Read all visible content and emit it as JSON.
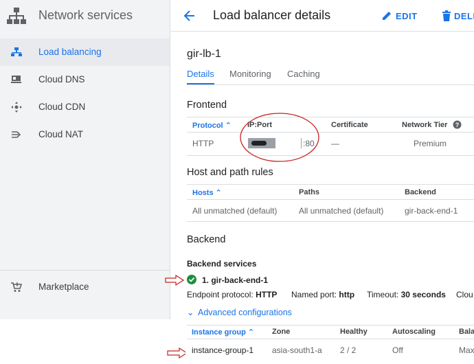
{
  "sidebar": {
    "title": "Network services",
    "items": [
      {
        "label": "Load balancing",
        "icon": "load-balancing-icon",
        "active": true
      },
      {
        "label": "Cloud DNS",
        "icon": "dns-icon"
      },
      {
        "label": "Cloud CDN",
        "icon": "cdn-icon"
      },
      {
        "label": "Cloud NAT",
        "icon": "nat-icon"
      }
    ],
    "bottom_items": [
      {
        "label": "Marketplace",
        "icon": "cart-icon"
      }
    ]
  },
  "topbar": {
    "title": "Load balancer details",
    "edit_label": "EDIT",
    "delete_label": "DELE"
  },
  "lb": {
    "name": "gir-lb-1",
    "tabs": [
      "Details",
      "Monitoring",
      "Caching"
    ]
  },
  "frontend": {
    "heading": "Frontend",
    "headers": {
      "protocol": "Protocol",
      "ip_port": "IP:Port",
      "certificate": "Certificate",
      "network_tier": "Network Tier"
    },
    "row": {
      "protocol": "HTTP",
      "port": ":80",
      "certificate": "—",
      "network_tier": "Premium"
    }
  },
  "host_rules": {
    "heading": "Host and path rules",
    "headers": {
      "hosts": "Hosts",
      "paths": "Paths",
      "backend": "Backend"
    },
    "row": {
      "hosts": "All unmatched (default)",
      "paths": "All unmatched (default)",
      "backend": "gir-back-end-1"
    }
  },
  "backend": {
    "heading": "Backend",
    "services_heading": "Backend services",
    "service_name": "1. gir-back-end-1",
    "endpoint_protocol_label": "Endpoint protocol:",
    "endpoint_protocol": "HTTP",
    "named_port_label": "Named port:",
    "named_port": "http",
    "timeout_label": "Timeout:",
    "timeout": "30 seconds",
    "cloud_trunc": "Clou",
    "advanced_label": "Advanced configurations",
    "ig_headers": {
      "instance_group": "Instance group",
      "zone": "Zone",
      "healthy": "Healthy",
      "autoscaling": "Autoscaling",
      "balancing": "Bala"
    },
    "ig_row": {
      "instance_group": "instance-group-1",
      "zone": "asia-south1-a",
      "healthy": "2 / 2",
      "autoscaling": "Off",
      "balancing": "Max"
    }
  },
  "colors": {
    "accent": "#1a73e8",
    "annotation": "#c5221f",
    "healthy": "#1e8e3e"
  }
}
